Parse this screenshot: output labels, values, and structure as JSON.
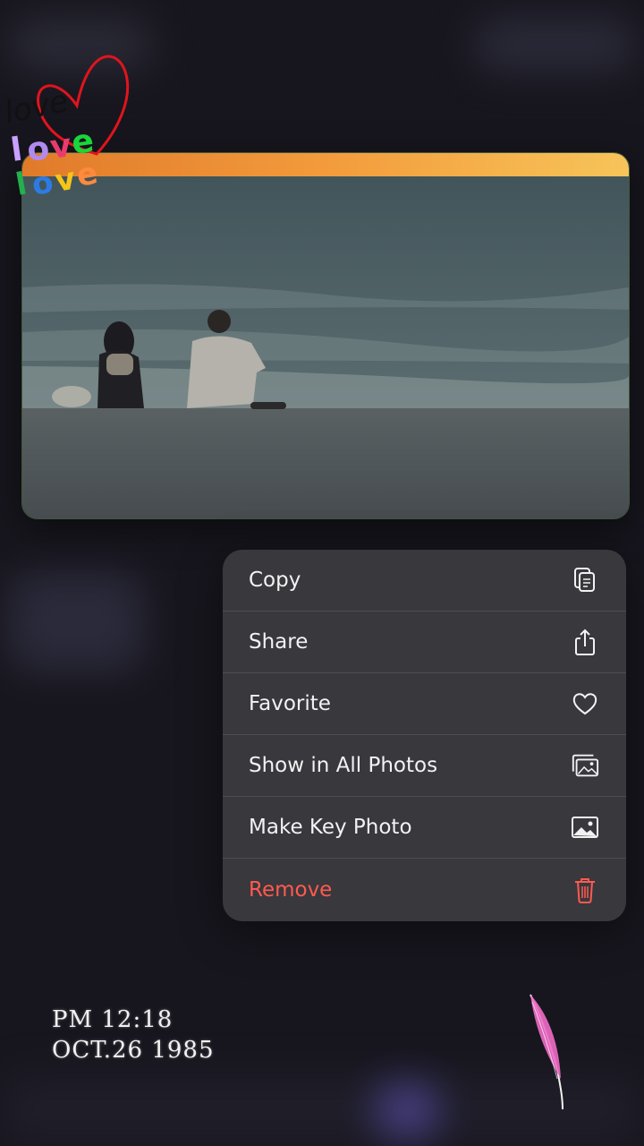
{
  "menu": {
    "items": [
      {
        "label": "Copy",
        "icon": "copy-icon"
      },
      {
        "label": "Share",
        "icon": "share-icon"
      },
      {
        "label": "Favorite",
        "icon": "heart-icon"
      },
      {
        "label": "Show in All Photos",
        "icon": "photos-stack-icon"
      },
      {
        "label": "Make Key Photo",
        "icon": "photo-icon"
      },
      {
        "label": "Remove",
        "icon": "trash-icon",
        "destructive": true
      }
    ],
    "destructive_color": "#ff5a4e"
  },
  "stickers": {
    "words": [
      "love",
      "love",
      "love"
    ]
  },
  "timestamp": {
    "time": "PM 12:18",
    "date": "OCT.26 1985"
  }
}
